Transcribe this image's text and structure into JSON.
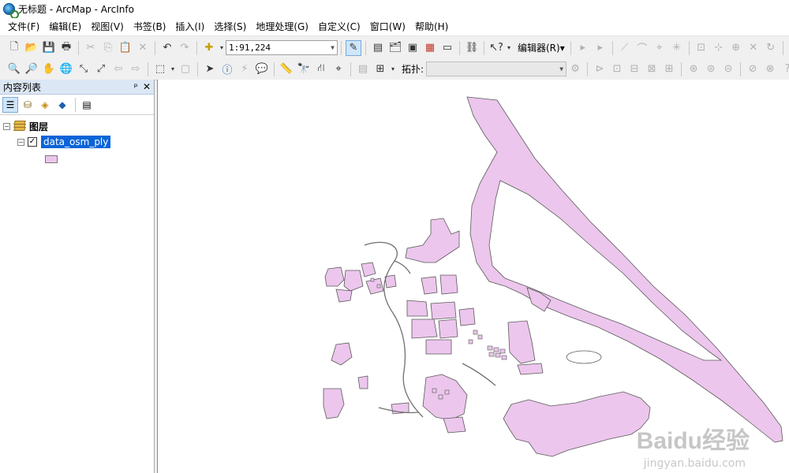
{
  "window": {
    "title": "无标题 - ArcMap - ArcInfo"
  },
  "menu": [
    "文件(F)",
    "编辑(E)",
    "视图(V)",
    "书签(B)",
    "插入(I)",
    "选择(S)",
    "地理处理(G)",
    "自定义(C)",
    "窗口(W)",
    "帮助(H)"
  ],
  "toolbar": {
    "scale": "1:91,224",
    "editor_label": "编辑器(R)▾",
    "topology_label": "拓扑:"
  },
  "toc": {
    "title": "内容列表",
    "pin": "ᵖ",
    "close": "✕",
    "group_label": "图层",
    "layer_name": "data_osm_ply",
    "layer_checked": "✓"
  },
  "colors": {
    "polygon_fill": "#ecc6ec",
    "polygon_stroke": "#5a5a5a",
    "selection": "#0a64d8"
  },
  "watermark": {
    "main": "Baidu经验",
    "sub": "jingyan.baidu.com"
  }
}
